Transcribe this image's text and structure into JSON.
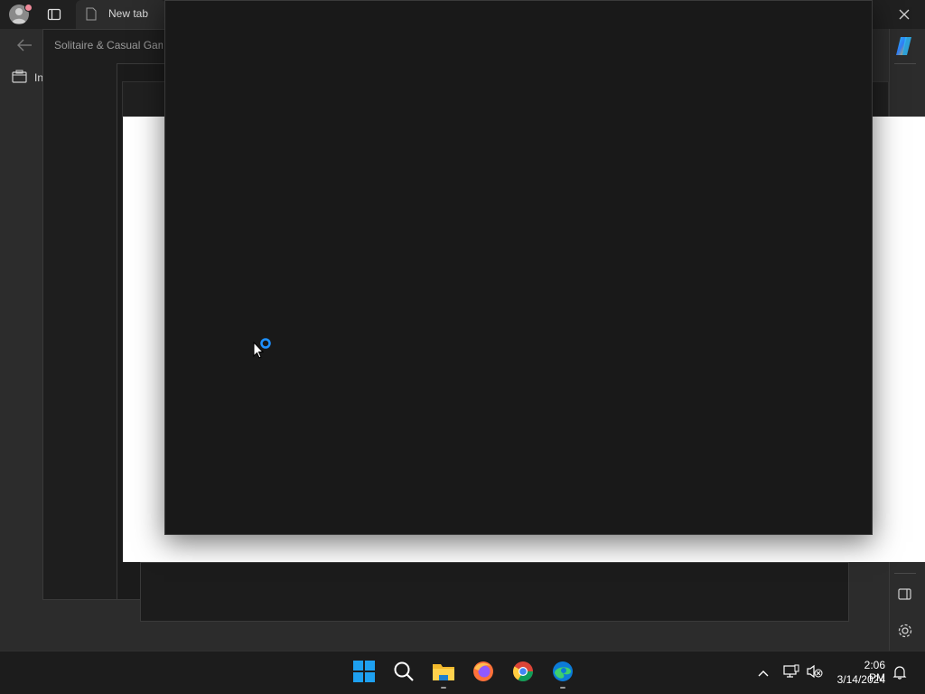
{
  "browser": {
    "tab_title": "New tab",
    "sidebar_label": "In"
  },
  "game": {
    "window_title": "Solitaire & Casual Gam"
  },
  "taskbar": {
    "clock_time": "2:06 PM",
    "clock_date": "3/14/2024",
    "pinned": [
      "start-icon",
      "search-icon",
      "file-explorer-icon",
      "firefox-icon",
      "chrome-icon",
      "edge-icon"
    ]
  },
  "colors": {
    "accent_blue": "#1e90ff",
    "window_dark": "#191919",
    "taskbar": "#1c1c1c"
  }
}
